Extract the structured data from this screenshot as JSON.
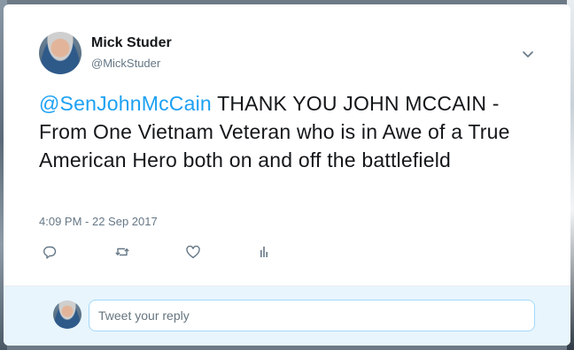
{
  "tweet": {
    "user_name": "Mick Studer",
    "user_handle": "@MickStuder",
    "mention": "@SenJohnMcCain",
    "text": " THANK YOU JOHN MCCAIN - From One Vietnam Veteran who is in Awe of a True American Hero both on and off the battlefield",
    "timestamp": "4:09 PM - 22 Sep 2017",
    "actions": [
      "reply-icon",
      "retweet-icon",
      "like-icon",
      "analytics-icon"
    ]
  },
  "reply": {
    "placeholder": "Tweet your reply"
  },
  "colors": {
    "link": "#1da1f2",
    "text": "#14171a",
    "secondary": "#657786",
    "reply_bar": "#e8f5fd"
  }
}
